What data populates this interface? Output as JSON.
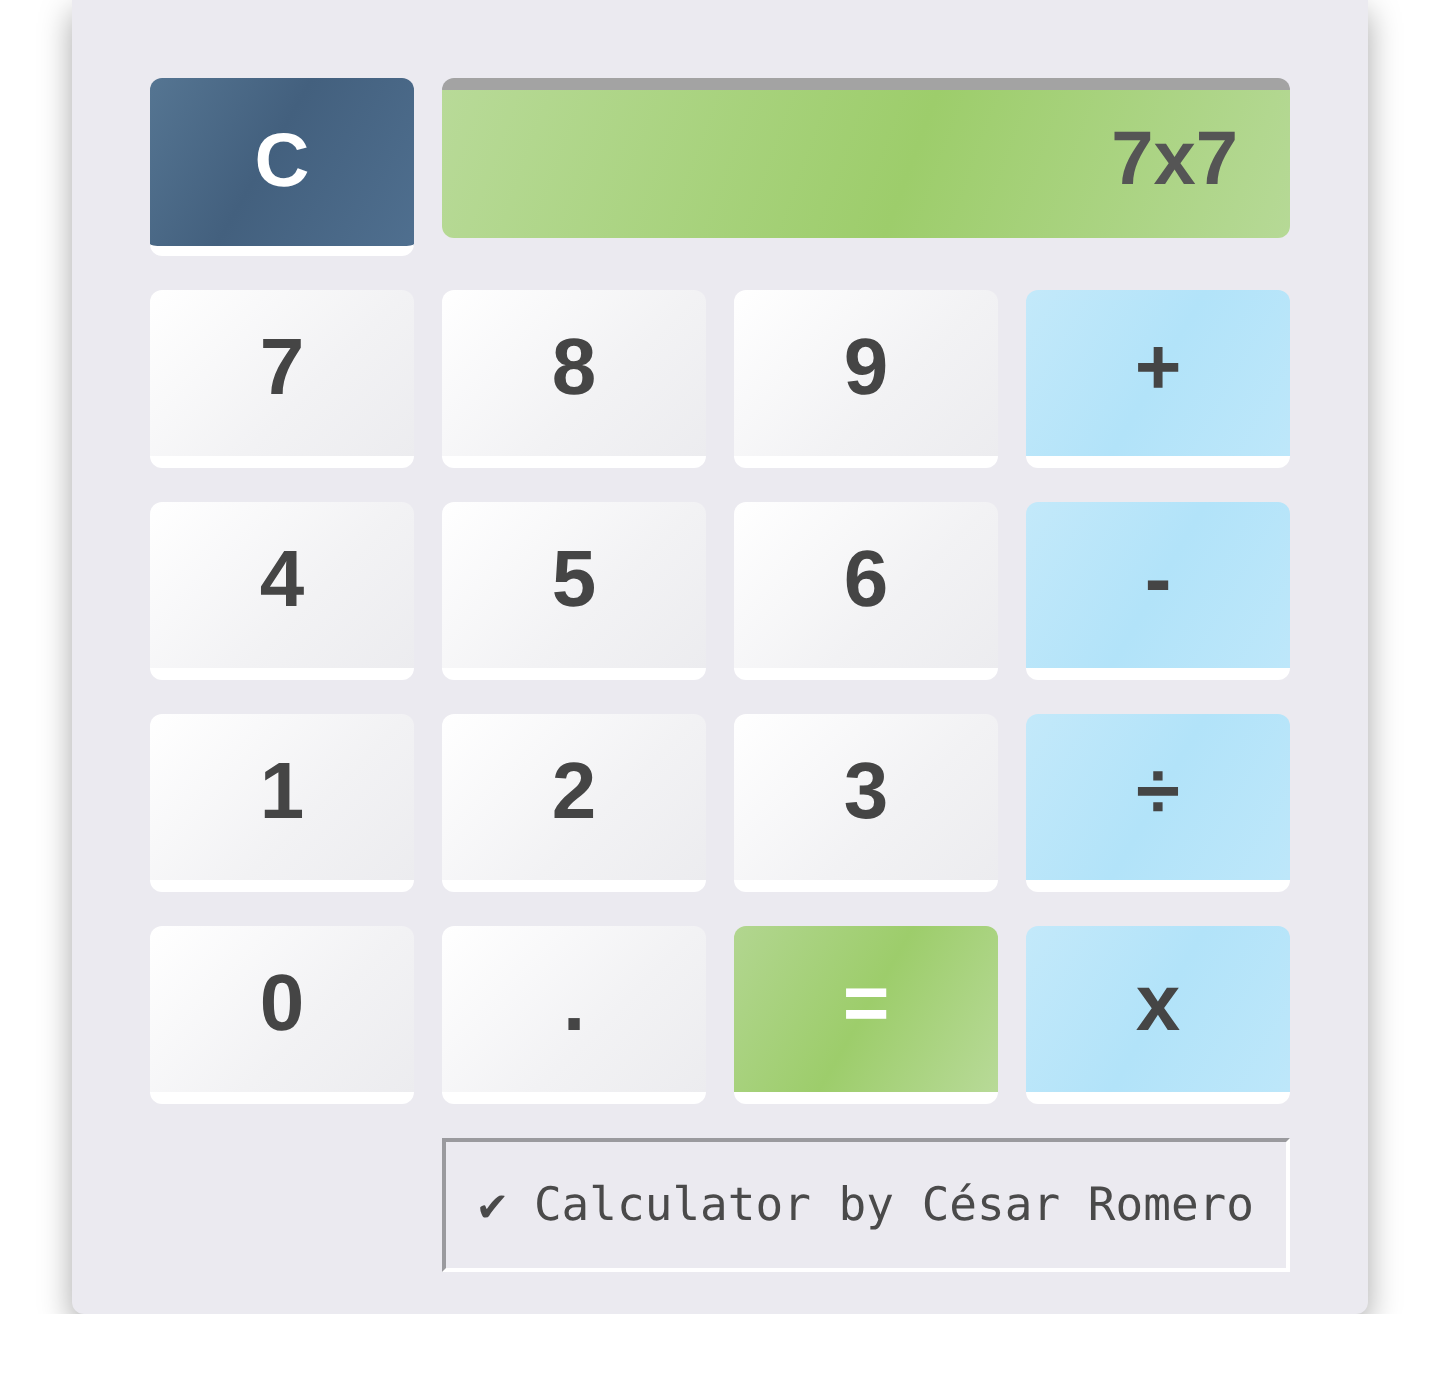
{
  "clear_button": {
    "label": "C"
  },
  "display": {
    "value": "7x7"
  },
  "keys": [
    {
      "label": "7",
      "kind": "digit"
    },
    {
      "label": "8",
      "kind": "digit"
    },
    {
      "label": "9",
      "kind": "digit"
    },
    {
      "label": "+",
      "kind": "operator"
    },
    {
      "label": "4",
      "kind": "digit"
    },
    {
      "label": "5",
      "kind": "digit"
    },
    {
      "label": "6",
      "kind": "digit"
    },
    {
      "label": "-",
      "kind": "operator"
    },
    {
      "label": "1",
      "kind": "digit"
    },
    {
      "label": "2",
      "kind": "digit"
    },
    {
      "label": "3",
      "kind": "digit"
    },
    {
      "label": "÷",
      "kind": "operator"
    },
    {
      "label": "0",
      "kind": "digit"
    },
    {
      "label": ".",
      "kind": "digit"
    },
    {
      "label": "=",
      "kind": "equals"
    },
    {
      "label": "x",
      "kind": "operator"
    }
  ],
  "footer": {
    "text": "✔ Calculator by César Romero"
  }
}
